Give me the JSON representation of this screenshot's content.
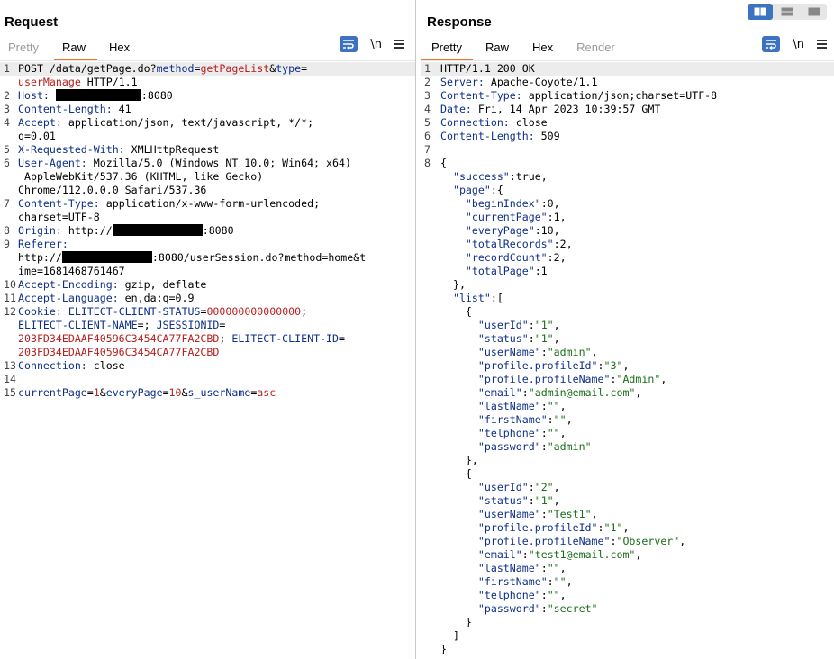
{
  "request": {
    "title": "Request",
    "tabs": [
      {
        "label": "Pretty",
        "state": "disabled"
      },
      {
        "label": "Raw",
        "state": "active"
      },
      {
        "label": "Hex",
        "state": "normal"
      }
    ],
    "newline_label": "\\n",
    "lines": [
      {
        "num": "1",
        "hl": true,
        "segs": [
          [
            "POST /data/getPage.do?",
            ""
          ],
          [
            "method",
            "k"
          ],
          [
            "=",
            ""
          ],
          [
            "getPageList",
            "r"
          ],
          [
            "&",
            ""
          ],
          [
            "type",
            "k"
          ],
          [
            "=",
            ""
          ]
        ]
      },
      {
        "num": "",
        "segs": [
          [
            "userManage",
            "r"
          ],
          [
            " HTTP/1.1",
            ""
          ]
        ]
      },
      {
        "num": "2",
        "segs": [
          [
            "Host:",
            "k"
          ],
          [
            " ",
            ""
          ],
          [
            "#R95",
            ""
          ],
          [
            ":8080",
            ""
          ]
        ]
      },
      {
        "num": "3",
        "segs": [
          [
            "Content-Length:",
            "k"
          ],
          [
            " 41",
            ""
          ]
        ]
      },
      {
        "num": "4",
        "segs": [
          [
            "Accept:",
            "k"
          ],
          [
            " application/json, text/javascript, */*;",
            ""
          ]
        ]
      },
      {
        "num": "",
        "segs": [
          [
            "q=0.01",
            ""
          ]
        ]
      },
      {
        "num": "5",
        "segs": [
          [
            "X-Requested-With:",
            "k"
          ],
          [
            " XMLHttpRequest",
            ""
          ]
        ]
      },
      {
        "num": "6",
        "segs": [
          [
            "User-Agent:",
            "k"
          ],
          [
            " Mozilla/5.0 (Windows NT 10.0; Win64; x64)",
            ""
          ]
        ]
      },
      {
        "num": "",
        "segs": [
          [
            " AppleWebKit/537.36 (KHTML, like Gecko)",
            ""
          ]
        ]
      },
      {
        "num": "",
        "segs": [
          [
            "Chrome/112.0.0.0 Safari/537.36",
            ""
          ]
        ]
      },
      {
        "num": "7",
        "segs": [
          [
            "Content-Type:",
            "k"
          ],
          [
            " application/x-www-form-urlencoded;",
            ""
          ]
        ]
      },
      {
        "num": "",
        "segs": [
          [
            "charset=UTF-8",
            ""
          ]
        ]
      },
      {
        "num": "8",
        "segs": [
          [
            "Origin:",
            "k"
          ],
          [
            " http://",
            ""
          ],
          [
            "#R100",
            ""
          ],
          [
            ":8080",
            ""
          ]
        ]
      },
      {
        "num": "9",
        "segs": [
          [
            "Referer:",
            "k"
          ]
        ]
      },
      {
        "num": "",
        "segs": [
          [
            "http://",
            ""
          ],
          [
            "#R100",
            ""
          ],
          [
            ":8080/userSession.do?method=home&t",
            ""
          ]
        ]
      },
      {
        "num": "",
        "segs": [
          [
            "ime=1681468761467",
            ""
          ]
        ]
      },
      {
        "num": "10",
        "segs": [
          [
            "Accept-Encoding:",
            "k"
          ],
          [
            " gzip, deflate",
            ""
          ]
        ]
      },
      {
        "num": "11",
        "segs": [
          [
            "Accept-Language:",
            "k"
          ],
          [
            " en,da;q=0.9",
            ""
          ]
        ]
      },
      {
        "num": "12",
        "segs": [
          [
            "Cookie:",
            "k"
          ],
          [
            " ",
            ""
          ],
          [
            "ELITECT-CLIENT-STATUS",
            "k"
          ],
          [
            "=",
            ""
          ],
          [
            "000000000000000",
            "r"
          ],
          [
            ";",
            ""
          ]
        ]
      },
      {
        "num": "",
        "segs": [
          [
            "ELITECT-CLIENT-NAME",
            "k"
          ],
          [
            "=; ",
            ""
          ],
          [
            "JSESSIONID",
            "k"
          ],
          [
            "=",
            ""
          ]
        ]
      },
      {
        "num": "",
        "segs": [
          [
            "203FD34EDAAF40596C3454CA77FA2CBD",
            "r"
          ],
          [
            "; ",
            ""
          ],
          [
            "ELITECT-CLIENT-ID",
            "k"
          ],
          [
            "=",
            ""
          ]
        ]
      },
      {
        "num": "",
        "segs": [
          [
            "203FD34EDAAF40596C3454CA77FA2CBD",
            "r"
          ]
        ]
      },
      {
        "num": "13",
        "segs": [
          [
            "Connection:",
            "k"
          ],
          [
            " close",
            ""
          ]
        ]
      },
      {
        "num": "14",
        "segs": []
      },
      {
        "num": "15",
        "segs": [
          [
            "currentPage",
            "k"
          ],
          [
            "=",
            ""
          ],
          [
            "1",
            "r"
          ],
          [
            "&",
            ""
          ],
          [
            "everyPage",
            "k"
          ],
          [
            "=",
            ""
          ],
          [
            "10",
            "r"
          ],
          [
            "&",
            ""
          ],
          [
            "s_userName",
            "k"
          ],
          [
            "=",
            ""
          ],
          [
            "asc",
            "r"
          ]
        ]
      }
    ]
  },
  "response": {
    "title": "Response",
    "tabs": [
      {
        "label": "Pretty",
        "state": "active"
      },
      {
        "label": "Raw",
        "state": "normal"
      },
      {
        "label": "Hex",
        "state": "normal"
      },
      {
        "label": "Render",
        "state": "disabled"
      }
    ],
    "newline_label": "\\n",
    "lines": [
      {
        "num": "1",
        "hl": true,
        "segs": [
          [
            "HTTP/1.1 200 OK",
            ""
          ]
        ]
      },
      {
        "num": "2",
        "segs": [
          [
            "Server:",
            "k"
          ],
          [
            " Apache-Coyote/1.1",
            ""
          ]
        ]
      },
      {
        "num": "3",
        "segs": [
          [
            "Content-Type:",
            "k"
          ],
          [
            " application/json;charset=UTF-8",
            ""
          ]
        ]
      },
      {
        "num": "4",
        "segs": [
          [
            "Date:",
            "k"
          ],
          [
            " Fri, 14 Apr 2023 10:39:57 GMT",
            ""
          ]
        ]
      },
      {
        "num": "5",
        "segs": [
          [
            "Connection:",
            "k"
          ],
          [
            " close",
            ""
          ]
        ]
      },
      {
        "num": "6",
        "segs": [
          [
            "Content-Length:",
            "k"
          ],
          [
            " 509",
            ""
          ]
        ]
      },
      {
        "num": "7",
        "segs": []
      },
      {
        "num": "8",
        "segs": [
          [
            "{",
            ""
          ]
        ]
      },
      {
        "num": "",
        "segs": [
          [
            "  ",
            ""
          ],
          [
            "\"success\"",
            "k"
          ],
          [
            ":true,",
            ""
          ]
        ]
      },
      {
        "num": "",
        "segs": [
          [
            "  ",
            ""
          ],
          [
            "\"page\"",
            "k"
          ],
          [
            ":{",
            ""
          ]
        ]
      },
      {
        "num": "",
        "segs": [
          [
            "    ",
            ""
          ],
          [
            "\"beginIndex\"",
            "k"
          ],
          [
            ":0,",
            ""
          ]
        ]
      },
      {
        "num": "",
        "segs": [
          [
            "    ",
            ""
          ],
          [
            "\"currentPage\"",
            "k"
          ],
          [
            ":1,",
            ""
          ]
        ]
      },
      {
        "num": "",
        "segs": [
          [
            "    ",
            ""
          ],
          [
            "\"everyPage\"",
            "k"
          ],
          [
            ":10,",
            ""
          ]
        ]
      },
      {
        "num": "",
        "segs": [
          [
            "    ",
            ""
          ],
          [
            "\"totalRecords\"",
            "k"
          ],
          [
            ":2,",
            ""
          ]
        ]
      },
      {
        "num": "",
        "segs": [
          [
            "    ",
            ""
          ],
          [
            "\"recordCount\"",
            "k"
          ],
          [
            ":2,",
            ""
          ]
        ]
      },
      {
        "num": "",
        "segs": [
          [
            "    ",
            ""
          ],
          [
            "\"totalPage\"",
            "k"
          ],
          [
            ":1",
            ""
          ]
        ]
      },
      {
        "num": "",
        "segs": [
          [
            "  },",
            ""
          ]
        ]
      },
      {
        "num": "",
        "segs": [
          [
            "  ",
            ""
          ],
          [
            "\"list\"",
            "k"
          ],
          [
            ":[",
            ""
          ]
        ]
      },
      {
        "num": "",
        "segs": [
          [
            "    {",
            ""
          ]
        ]
      },
      {
        "num": "",
        "segs": [
          [
            "      ",
            ""
          ],
          [
            "\"userId\"",
            "k"
          ],
          [
            ":",
            ""
          ],
          [
            "\"1\"",
            "s"
          ],
          [
            ",",
            ""
          ]
        ]
      },
      {
        "num": "",
        "segs": [
          [
            "      ",
            ""
          ],
          [
            "\"status\"",
            "k"
          ],
          [
            ":",
            ""
          ],
          [
            "\"1\"",
            "s"
          ],
          [
            ",",
            ""
          ]
        ]
      },
      {
        "num": "",
        "segs": [
          [
            "      ",
            ""
          ],
          [
            "\"userName\"",
            "k"
          ],
          [
            ":",
            ""
          ],
          [
            "\"admin\"",
            "s"
          ],
          [
            ",",
            ""
          ]
        ]
      },
      {
        "num": "",
        "segs": [
          [
            "      ",
            ""
          ],
          [
            "\"profile.profileId\"",
            "k"
          ],
          [
            ":",
            ""
          ],
          [
            "\"3\"",
            "s"
          ],
          [
            ",",
            ""
          ]
        ]
      },
      {
        "num": "",
        "segs": [
          [
            "      ",
            ""
          ],
          [
            "\"profile.profileName\"",
            "k"
          ],
          [
            ":",
            ""
          ],
          [
            "\"Admin\"",
            "s"
          ],
          [
            ",",
            ""
          ]
        ]
      },
      {
        "num": "",
        "segs": [
          [
            "      ",
            ""
          ],
          [
            "\"email\"",
            "k"
          ],
          [
            ":",
            ""
          ],
          [
            "\"admin@email.com\"",
            "s"
          ],
          [
            ",",
            ""
          ]
        ]
      },
      {
        "num": "",
        "segs": [
          [
            "      ",
            ""
          ],
          [
            "\"lastName\"",
            "k"
          ],
          [
            ":",
            ""
          ],
          [
            "\"\"",
            "s"
          ],
          [
            ",",
            ""
          ]
        ]
      },
      {
        "num": "",
        "segs": [
          [
            "      ",
            ""
          ],
          [
            "\"firstName\"",
            "k"
          ],
          [
            ":",
            ""
          ],
          [
            "\"\"",
            "s"
          ],
          [
            ",",
            ""
          ]
        ]
      },
      {
        "num": "",
        "segs": [
          [
            "      ",
            ""
          ],
          [
            "\"telphone\"",
            "k"
          ],
          [
            ":",
            ""
          ],
          [
            "\"\"",
            "s"
          ],
          [
            ",",
            ""
          ]
        ]
      },
      {
        "num": "",
        "segs": [
          [
            "      ",
            ""
          ],
          [
            "\"password\"",
            "k"
          ],
          [
            ":",
            ""
          ],
          [
            "\"admin\"",
            "s"
          ]
        ]
      },
      {
        "num": "",
        "segs": [
          [
            "    },",
            ""
          ]
        ]
      },
      {
        "num": "",
        "segs": [
          [
            "    {",
            ""
          ]
        ]
      },
      {
        "num": "",
        "segs": [
          [
            "      ",
            ""
          ],
          [
            "\"userId\"",
            "k"
          ],
          [
            ":",
            ""
          ],
          [
            "\"2\"",
            "s"
          ],
          [
            ",",
            ""
          ]
        ]
      },
      {
        "num": "",
        "segs": [
          [
            "      ",
            ""
          ],
          [
            "\"status\"",
            "k"
          ],
          [
            ":",
            ""
          ],
          [
            "\"1\"",
            "s"
          ],
          [
            ",",
            ""
          ]
        ]
      },
      {
        "num": "",
        "segs": [
          [
            "      ",
            ""
          ],
          [
            "\"userName\"",
            "k"
          ],
          [
            ":",
            ""
          ],
          [
            "\"Test1\"",
            "s"
          ],
          [
            ",",
            ""
          ]
        ]
      },
      {
        "num": "",
        "segs": [
          [
            "      ",
            ""
          ],
          [
            "\"profile.profileId\"",
            "k"
          ],
          [
            ":",
            ""
          ],
          [
            "\"1\"",
            "s"
          ],
          [
            ",",
            ""
          ]
        ]
      },
      {
        "num": "",
        "segs": [
          [
            "      ",
            ""
          ],
          [
            "\"profile.profileName\"",
            "k"
          ],
          [
            ":",
            ""
          ],
          [
            "\"Observer\"",
            "s"
          ],
          [
            ",",
            ""
          ]
        ]
      },
      {
        "num": "",
        "segs": [
          [
            "      ",
            ""
          ],
          [
            "\"email\"",
            "k"
          ],
          [
            ":",
            ""
          ],
          [
            "\"test1@email.com\"",
            "s"
          ],
          [
            ",",
            ""
          ]
        ]
      },
      {
        "num": "",
        "segs": [
          [
            "      ",
            ""
          ],
          [
            "\"lastName\"",
            "k"
          ],
          [
            ":",
            ""
          ],
          [
            "\"\"",
            "s"
          ],
          [
            ",",
            ""
          ]
        ]
      },
      {
        "num": "",
        "segs": [
          [
            "      ",
            ""
          ],
          [
            "\"firstName\"",
            "k"
          ],
          [
            ":",
            ""
          ],
          [
            "\"\"",
            "s"
          ],
          [
            ",",
            ""
          ]
        ]
      },
      {
        "num": "",
        "segs": [
          [
            "      ",
            ""
          ],
          [
            "\"telphone\"",
            "k"
          ],
          [
            ":",
            ""
          ],
          [
            "\"\"",
            "s"
          ],
          [
            ",",
            ""
          ]
        ]
      },
      {
        "num": "",
        "segs": [
          [
            "      ",
            ""
          ],
          [
            "\"password\"",
            "k"
          ],
          [
            ":",
            ""
          ],
          [
            "\"secret\"",
            "s"
          ]
        ]
      },
      {
        "num": "",
        "segs": [
          [
            "    }",
            ""
          ]
        ]
      },
      {
        "num": "",
        "segs": [
          [
            "  ]",
            ""
          ]
        ]
      },
      {
        "num": "",
        "segs": [
          [
            "}",
            ""
          ]
        ]
      }
    ]
  },
  "colors": {
    "accent": "#e8752f",
    "keyword": "#0f2f8a",
    "value": "#b62020",
    "string": "#1a6e1a",
    "button": "#3b72c2"
  },
  "view_toggle": [
    "side-by-side",
    "stacked",
    "single"
  ]
}
